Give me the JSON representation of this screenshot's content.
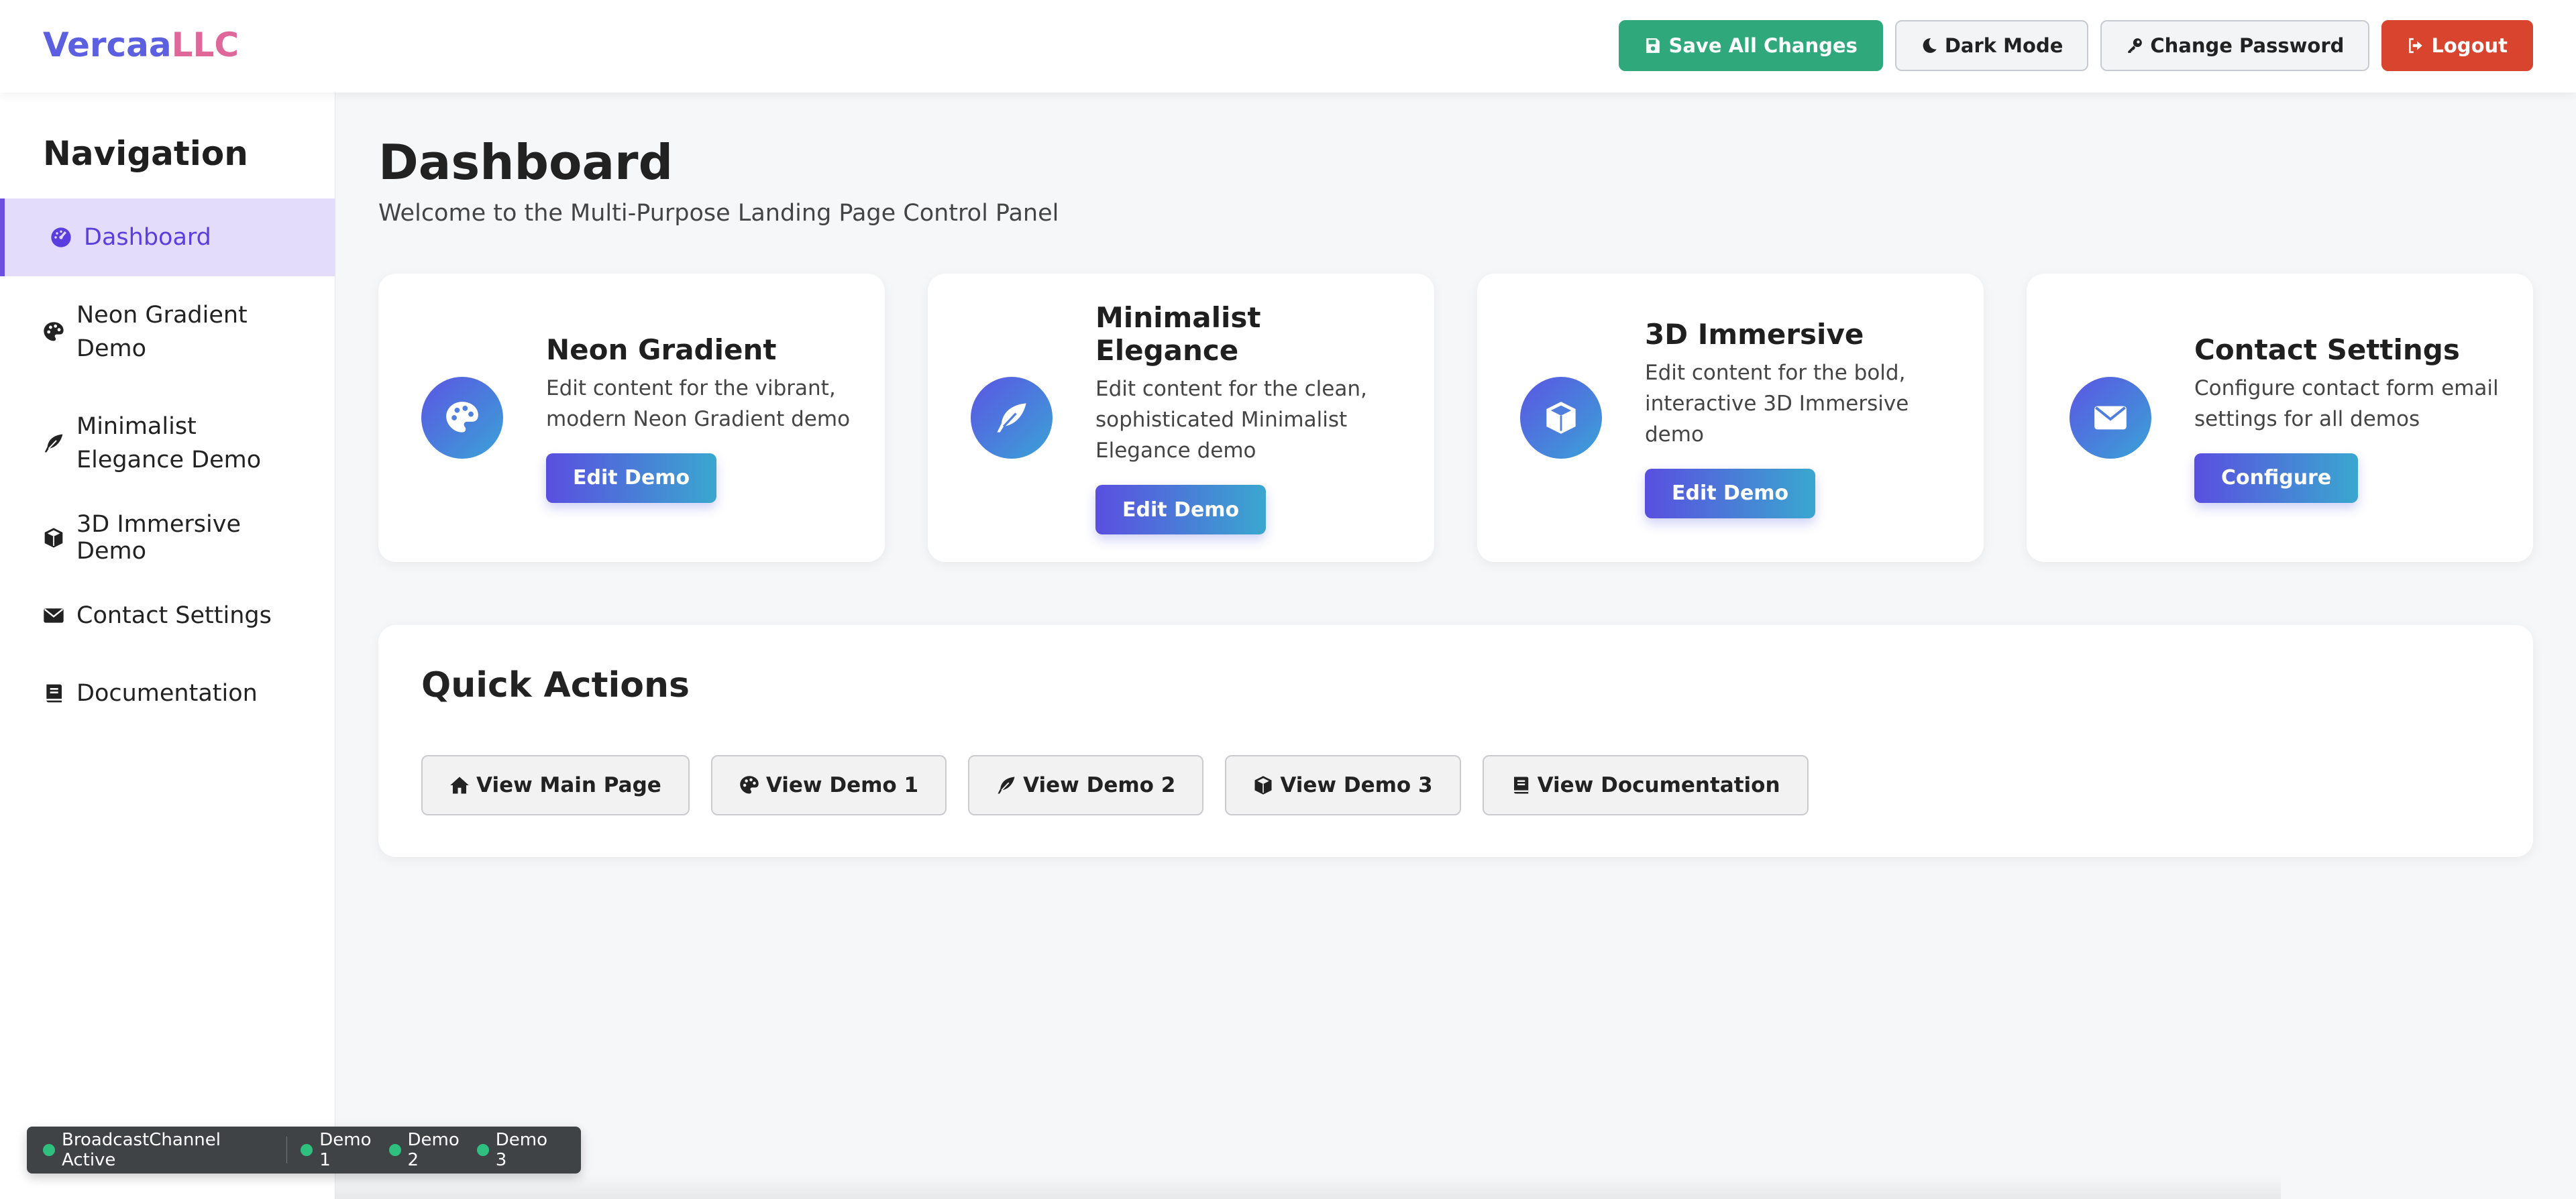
{
  "brand": {
    "part1": "Vercaa",
    "part2": "LLC"
  },
  "header": {
    "save_all": "Save All Changes",
    "dark_mode": "Dark Mode",
    "change_password": "Change Password",
    "logout": "Logout"
  },
  "sidebar": {
    "title": "Navigation",
    "items": [
      {
        "label": "Dashboard",
        "icon": "dashboard-icon",
        "active": true
      },
      {
        "label": "Neon Gradient Demo",
        "icon": "palette-icon"
      },
      {
        "label": "Minimalist Elegance Demo",
        "icon": "feather-icon"
      },
      {
        "label": "3D Immersive Demo",
        "icon": "cube-icon"
      },
      {
        "label": "Contact Settings",
        "icon": "envelope-icon"
      },
      {
        "label": "Documentation",
        "icon": "book-icon"
      }
    ]
  },
  "main": {
    "title": "Dashboard",
    "subtitle": "Welcome to the Multi-Purpose Landing Page Control Panel",
    "cards": [
      {
        "title": "Neon Gradient",
        "desc": "Edit content for the vibrant, modern Neon Gradient demo",
        "button": "Edit Demo",
        "icon": "palette-icon"
      },
      {
        "title": "Minimalist Elegance",
        "desc": "Edit content for the clean, sophisticated Minimalist Elegance demo",
        "button": "Edit Demo",
        "icon": "feather-icon"
      },
      {
        "title": "3D Immersive",
        "desc": "Edit content for the bold, interactive 3D Immersive demo",
        "button": "Edit Demo",
        "icon": "cube-icon"
      },
      {
        "title": "Contact Settings",
        "desc": "Configure contact form email settings for all demos",
        "button": "Configure",
        "icon": "envelope-icon"
      }
    ],
    "quick_actions": {
      "title": "Quick Actions",
      "buttons": [
        {
          "label": "View Main Page",
          "icon": "home-icon"
        },
        {
          "label": "View Demo 1",
          "icon": "palette-icon"
        },
        {
          "label": "View Demo 2",
          "icon": "feather-icon"
        },
        {
          "label": "View Demo 3",
          "icon": "cube-icon"
        },
        {
          "label": "View Documentation",
          "icon": "book-icon"
        }
      ]
    }
  },
  "status": {
    "broadcast": "BroadcastChannel Active",
    "demos": [
      "Demo 1",
      "Demo 2",
      "Demo 3"
    ]
  },
  "colors": {
    "accent": "#5b5fe0",
    "brand_pink": "#e0679a",
    "save_green": "#2fa97c",
    "logout_red": "#d9442e",
    "active_bg": "#e3dcfb",
    "status_dot": "#2fbf7f"
  }
}
